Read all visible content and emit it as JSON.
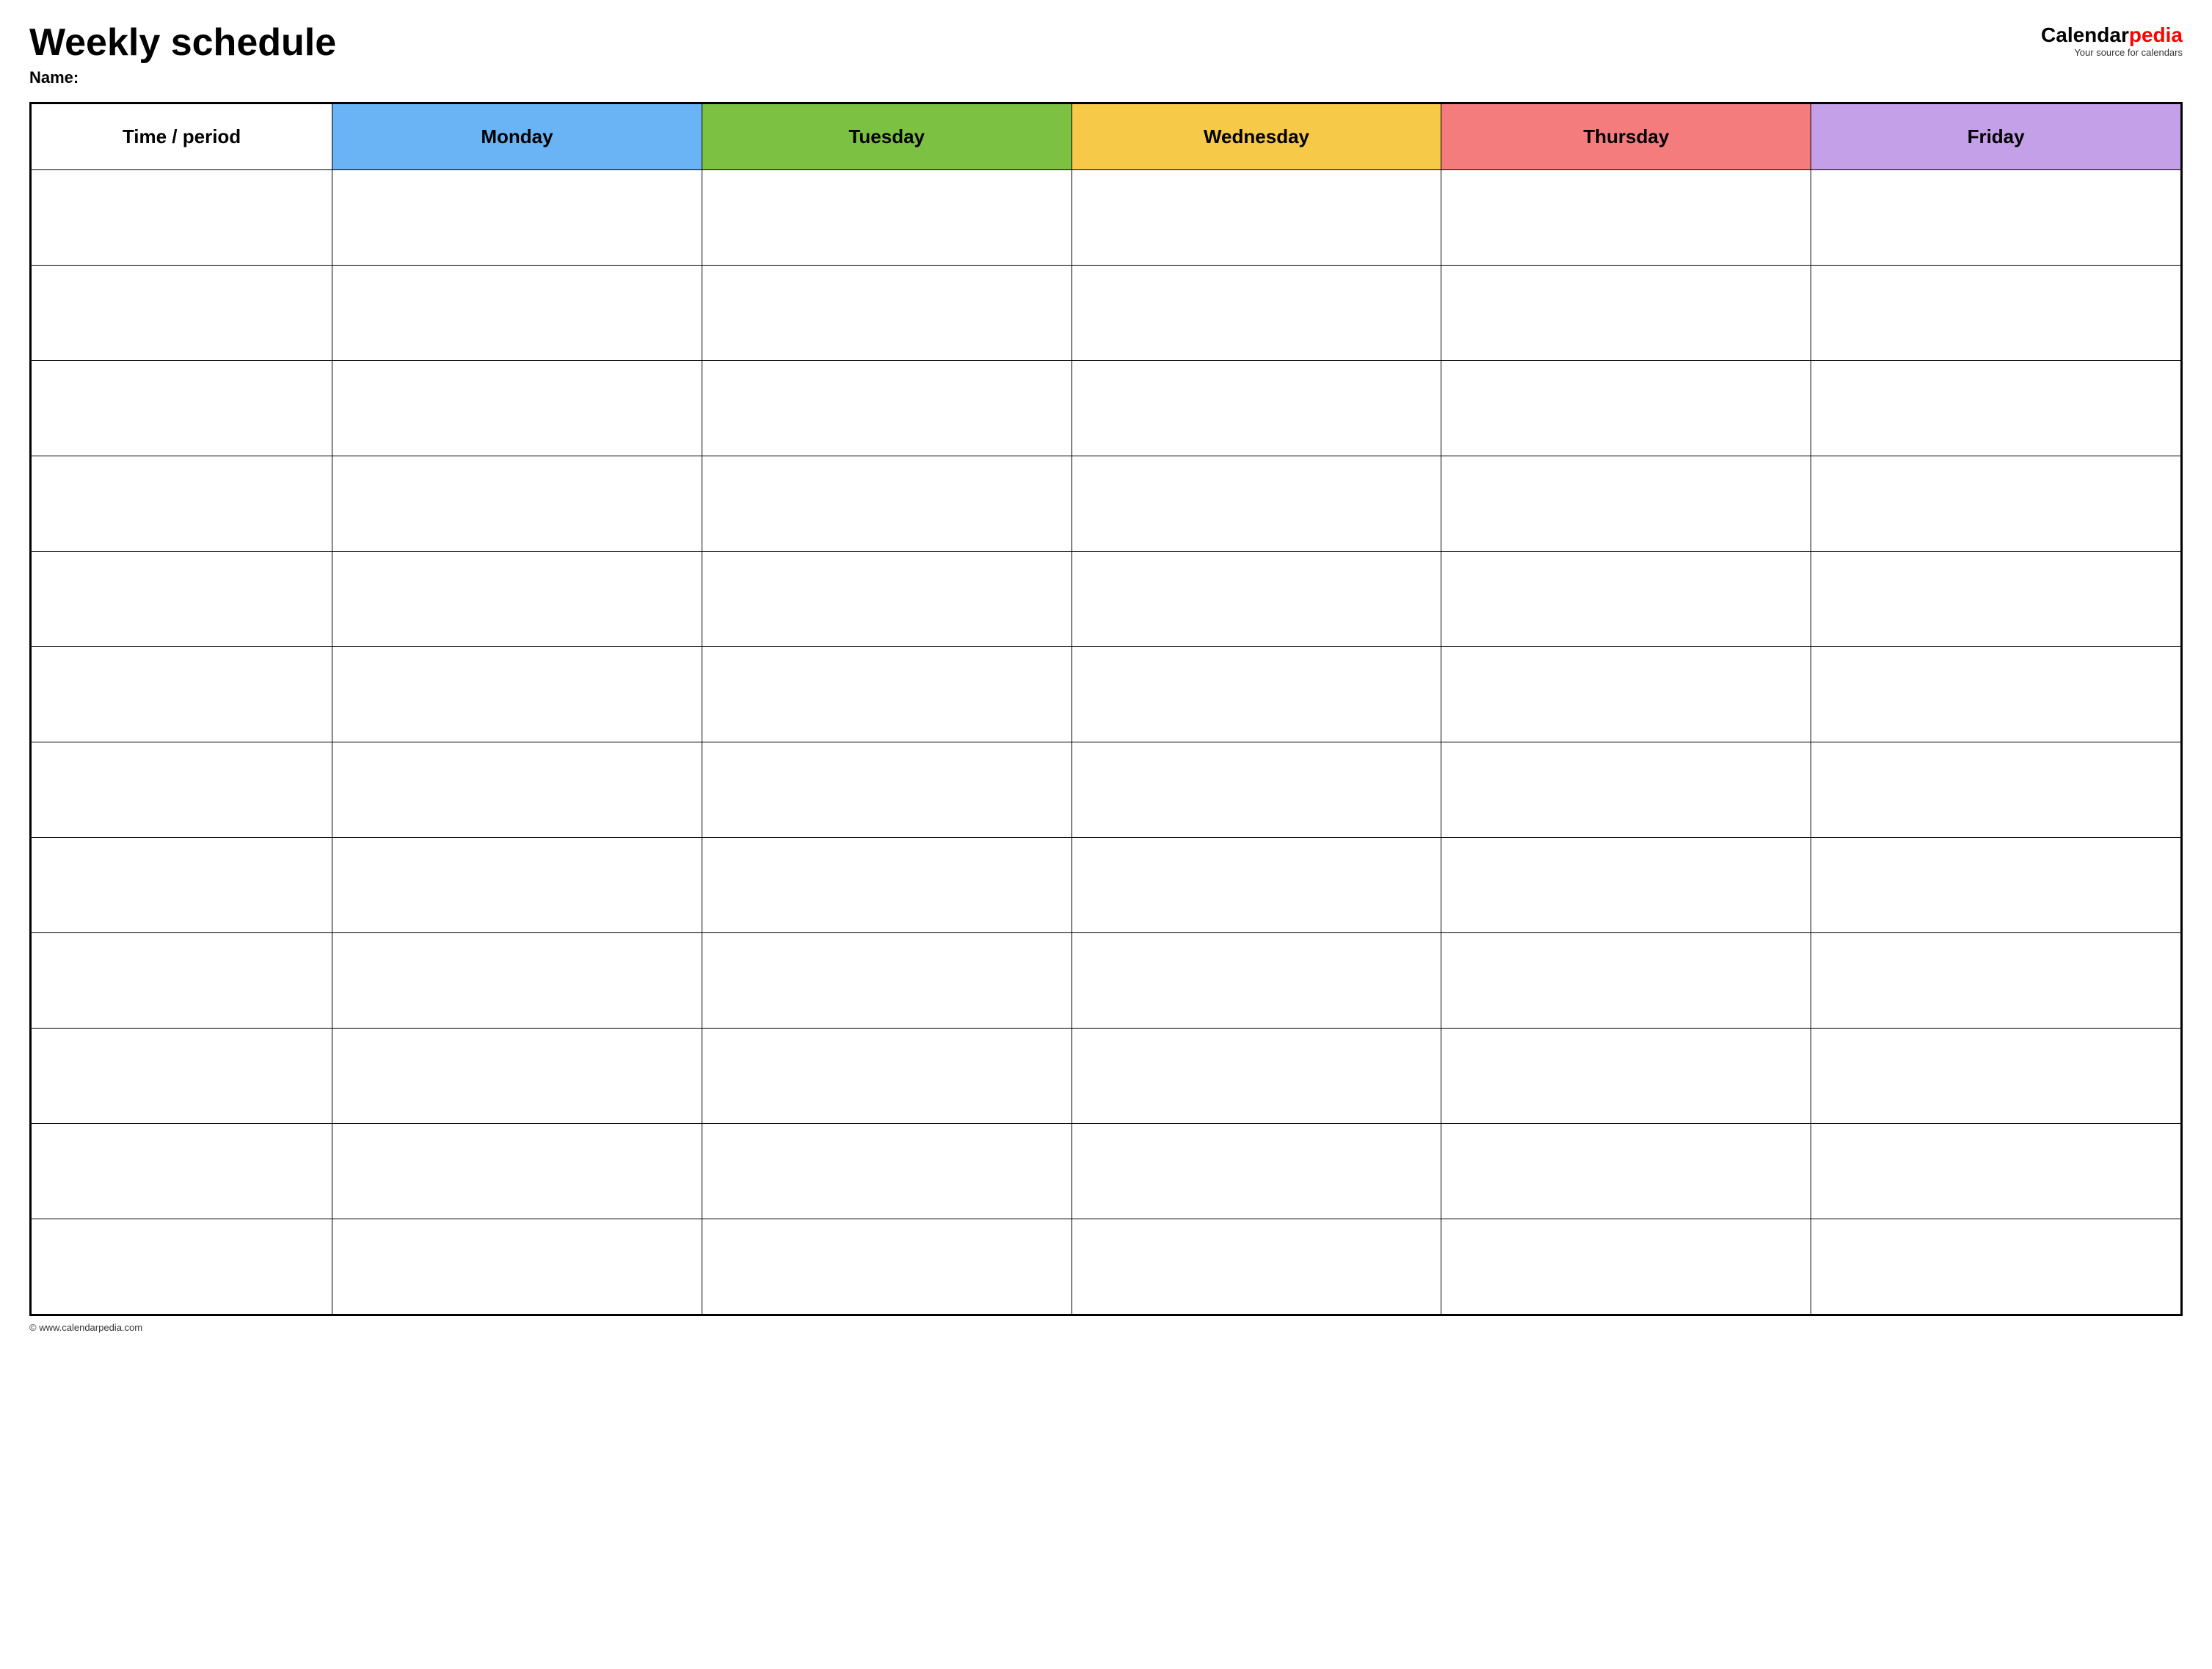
{
  "header": {
    "main_title": "Weekly schedule",
    "name_label": "Name:",
    "logo": {
      "calendar_text": "Calendar",
      "pedia_text": "pedia",
      "tagline": "Your source for calendars"
    }
  },
  "table": {
    "headers": [
      {
        "label": "Time / period",
        "class": "time-header"
      },
      {
        "label": "Monday",
        "class": "monday-header"
      },
      {
        "label": "Tuesday",
        "class": "tuesday-header"
      },
      {
        "label": "Wednesday",
        "class": "wednesday-header"
      },
      {
        "label": "Thursday",
        "class": "thursday-header"
      },
      {
        "label": "Friday",
        "class": "friday-header"
      }
    ],
    "row_count": 12
  },
  "footer": {
    "copyright": "© www.calendarpedia.com"
  }
}
